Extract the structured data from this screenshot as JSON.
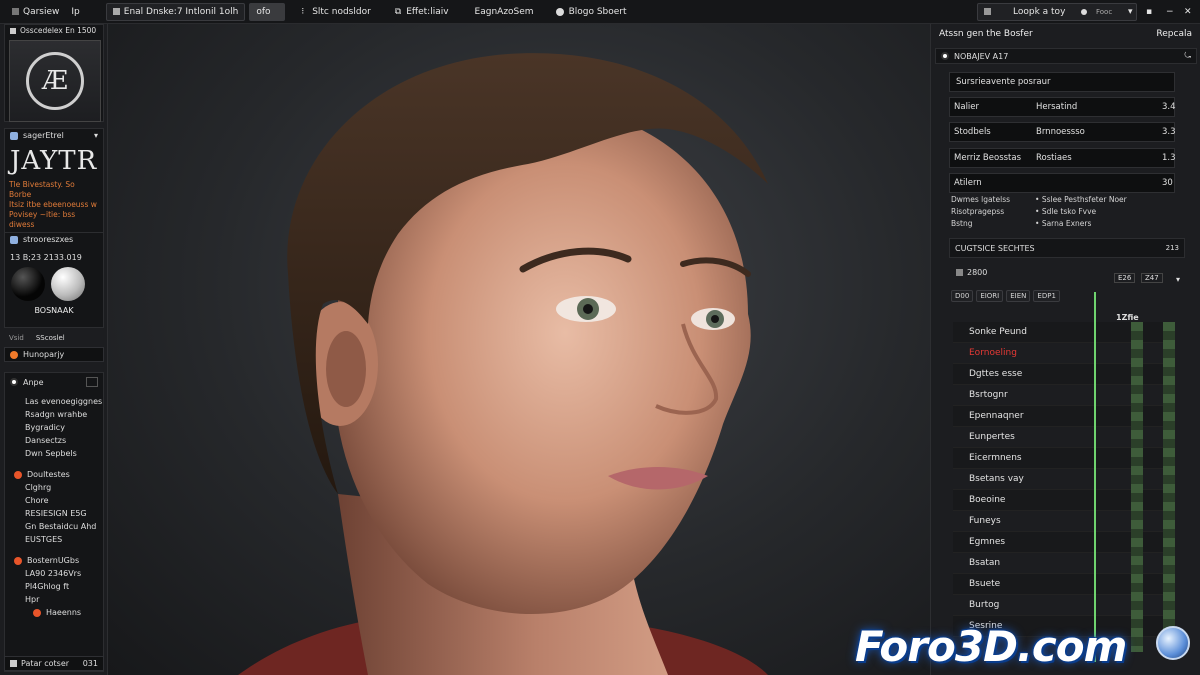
{
  "topbar": {
    "items": [
      "Qarsiew",
      "Ip",
      "Enal Dnske:7 Intlonil 1olh",
      "ofo",
      "Sltc nodsldor",
      "Effet:liaiv",
      "EagnAzoSem",
      "Blogo Sboert"
    ],
    "search_placeholder": "Loopk a toy",
    "right_label": "Fooc"
  },
  "left": {
    "header": "Osscedelex En 1500",
    "dropdown": "sagerEtrel",
    "big_title": "JAYTR",
    "orange_lines": [
      "Tle Bivestasty. So Borbe",
      "Itsiz itbe ebeenoeuss w",
      "Povisey ~itie: bss diwess"
    ],
    "materials_title": "strooreszxes",
    "materials_value": "13 B;23 2133.019",
    "material_name": "BOSNAAK",
    "label_a": "Vsid",
    "label_b": "SScoslel",
    "button": "Hunoparjy",
    "section_title": "Anpe",
    "list1": [
      "Las evenoegiggnes",
      "Rsadgn wrahbe",
      "Bygradicy",
      "Dansectzs",
      "Dwn Sepbels"
    ],
    "group2_title": "Doultestes",
    "list2": [
      "Clghrg",
      "Chore",
      "RESIESIGN E5G",
      "Gn Bestaidcu Ahd",
      "EUSTGES"
    ],
    "group3_title": "BosternUGbs",
    "list3": [
      "LA90 2346Vrs",
      "PI4Ghlog ft",
      "Hpr"
    ],
    "group3_button": "Haeenns",
    "footer_label": "Patar cotser",
    "footer_value": "031"
  },
  "right": {
    "header_left": "Atssn gen the Bosfer",
    "header_right": "Repcala",
    "sub_title": "NOBAJEV A17",
    "prop_title": "Sursrieavente posraur",
    "props": [
      {
        "label": "Nalier",
        "value": "Hersatind",
        "num": "3.4"
      },
      {
        "label": "Stodbels",
        "value": "Brnnoessso",
        "num": "3.3"
      },
      {
        "label": "Merriz Beosstas",
        "value": "Rostiaes",
        "num": "1.3"
      },
      {
        "label": "Atilern",
        "value": "",
        "num": "30"
      }
    ],
    "bullets_left": [
      "Dwmes lgatelss",
      "Risotpragepss",
      "Bstng"
    ],
    "bullets_right": [
      "Sslee Pesthsfeter Noer",
      "Sdle tsko Fvve",
      "Sarna Exners"
    ],
    "channels_title": "CUGTSICE SECHTES",
    "channels_num": "213",
    "frame_value": "2800",
    "frame_btn_a": "E26",
    "frame_btn_b": "Z47",
    "tabs": [
      "D00",
      "EIORI",
      "EIEN",
      "EDP1"
    ],
    "marker": "1Zfie",
    "channels": [
      "Sonke Peund",
      "Eornoeling",
      "Dgttes esse",
      "Bsrtognr",
      "Epennaqner",
      "Eunpertes",
      "Eicermnens",
      "Bsetans vay",
      "Boeoine",
      "Funeys",
      "Egmnes",
      "Bsatan",
      "Bsuete",
      "Burtog",
      "Sesrine"
    ],
    "channel_highlight_color": "#e53935"
  },
  "watermark": "Foro3D.com"
}
